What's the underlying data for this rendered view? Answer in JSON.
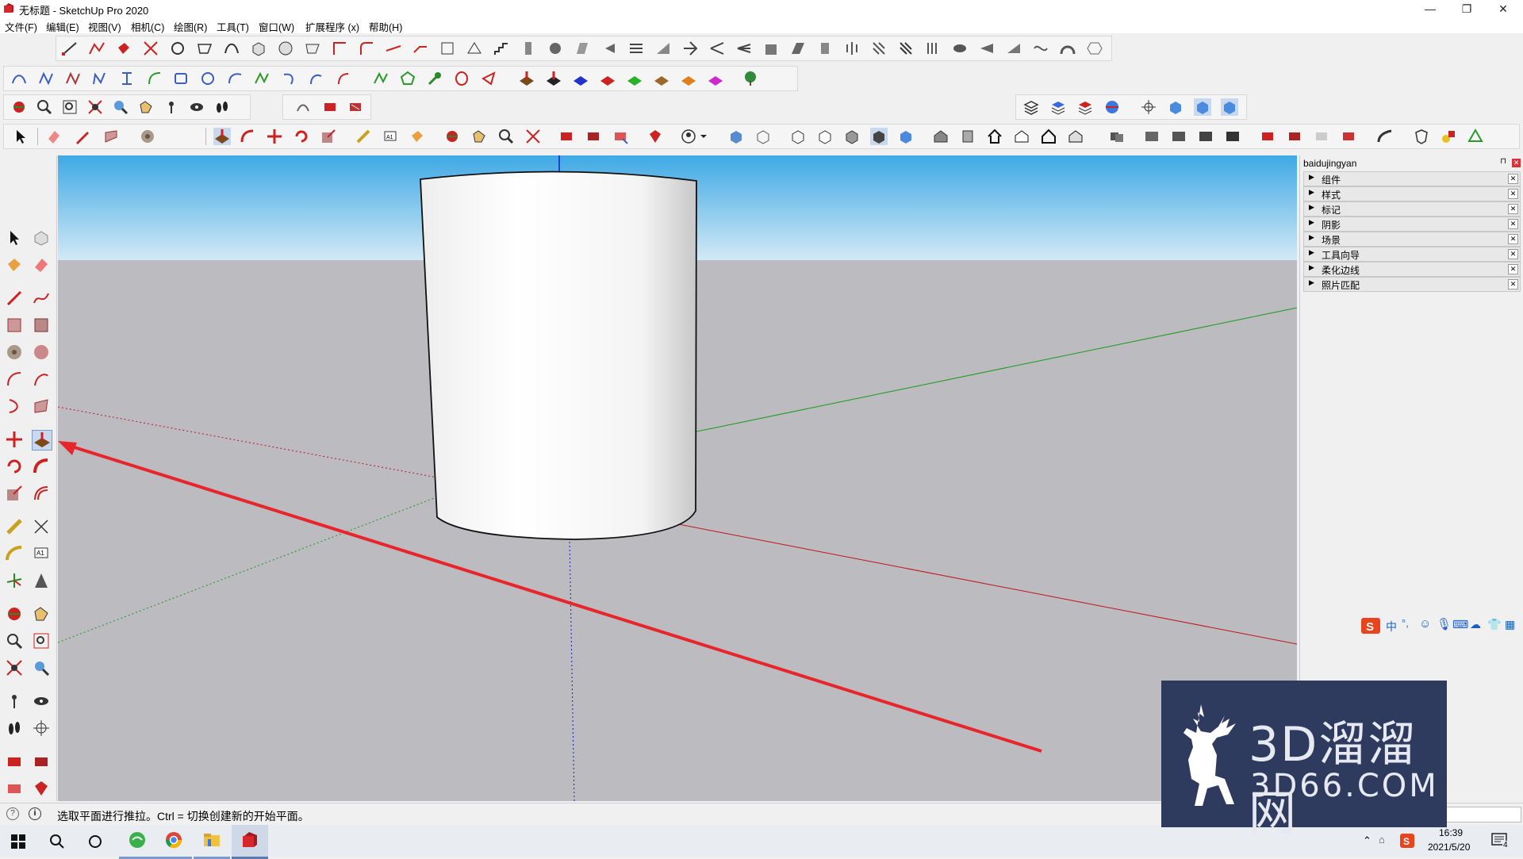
{
  "window": {
    "title": "无标题 - SketchUp Pro 2020",
    "controls": {
      "minimize": "—",
      "restore": "❐",
      "close": "✕"
    }
  },
  "menu": [
    "文件(F)",
    "编辑(E)",
    "视图(V)",
    "相机(C)",
    "绘图(R)",
    "工具(T)",
    "窗口(W)",
    "扩展程序 (x)",
    "帮助(H)"
  ],
  "tray": {
    "title": "baidujingyan",
    "panels": [
      "组件",
      "样式",
      "标记",
      "阴影",
      "场景",
      "工具向导",
      "柔化边线",
      "照片匹配"
    ]
  },
  "status": {
    "message": "选取平面进行推拉。Ctrl = 切换创建新的开始平面。"
  },
  "taskbar": {
    "time": "16:39",
    "date": "2021/5/20",
    "notification_count": "4"
  },
  "ime": {
    "lang": "中",
    "punct": "°,"
  },
  "watermark": {
    "brand": "3D溜溜网",
    "url": "3D66.COM"
  },
  "colors": {
    "sky_top": "#3fa9e5",
    "sky_bottom": "#cfe8f5",
    "ground": "#bbbbc0",
    "arrow": "#e8252b",
    "red_axis": "#c0141c",
    "green_axis": "#1a9a1a",
    "blue_axis": "#1a1acc",
    "watermark_bg": "#2e3a5e"
  }
}
